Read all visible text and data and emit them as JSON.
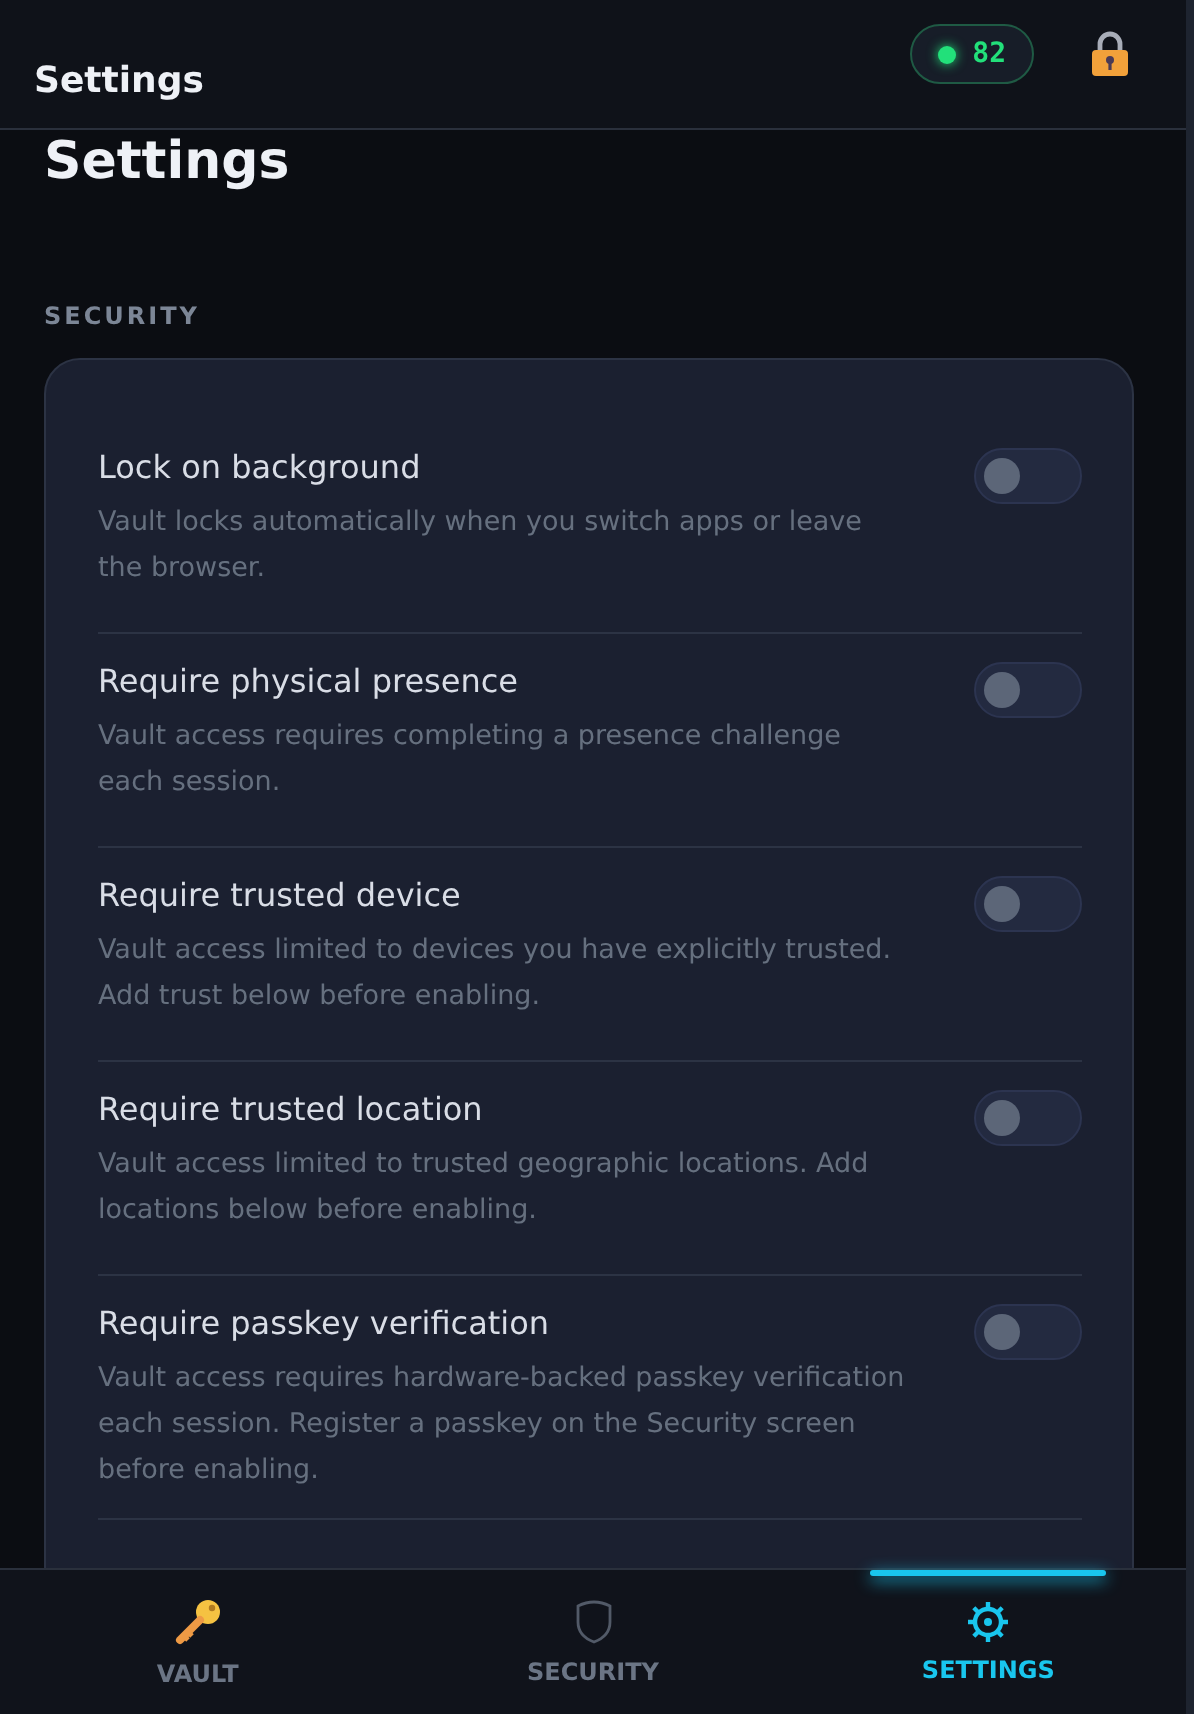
{
  "header": {
    "title": "Settings",
    "status": {
      "value": "82",
      "color": "#22e07a"
    }
  },
  "page_title": "Settings",
  "section": {
    "label": "SECURITY",
    "settings": [
      {
        "title": "Lock on background",
        "description": "Vault locks automatically when you switch apps or leave the browser.",
        "on": false
      },
      {
        "title": "Require physical presence",
        "description": "Vault access requires completing a presence challenge each session.",
        "on": false
      },
      {
        "title": "Require trusted device",
        "description": "Vault access limited to devices you have explicitly trusted. Add trust below before enabling.",
        "on": false
      },
      {
        "title": "Require trusted location",
        "description": "Vault access limited to trusted geographic locations. Add locations below before enabling.",
        "on": false
      },
      {
        "title": "Require passkey verification",
        "description": "Vault access requires hardware-backed passkey verification each session. Register a passkey on the Security screen before enabling.",
        "on": false
      }
    ]
  },
  "nav": [
    {
      "kind": "key",
      "label": "VAULT",
      "selected": false
    },
    {
      "kind": "shield",
      "label": "SECURITY",
      "selected": false
    },
    {
      "kind": "gear",
      "label": "SETTINGS",
      "selected": true
    }
  ]
}
